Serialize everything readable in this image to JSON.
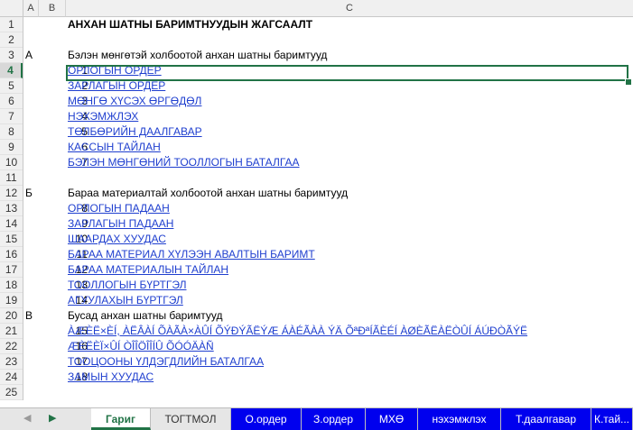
{
  "columns": {
    "a": "A",
    "b": "B",
    "c": "C"
  },
  "rows": [
    {
      "n": "1",
      "a": "",
      "num": "",
      "text": "АНХАН ШАТНЫ БАРИМТНУУДЫН ЖАГСААЛТ",
      "kind": "title"
    },
    {
      "n": "2",
      "a": "",
      "num": "",
      "text": "",
      "kind": "plain"
    },
    {
      "n": "3",
      "a": "А",
      "num": "",
      "text": "Бэлэн мөнгөтэй холбоотой анхан шатны баримтууд",
      "kind": "plain"
    },
    {
      "n": "4",
      "a": "",
      "num": "1",
      "text": "ОРЛОГЫН ОРДЕР",
      "kind": "link"
    },
    {
      "n": "5",
      "a": "",
      "num": "2",
      "text": "ЗАРЛАГЫН ОРДЕР",
      "kind": "link"
    },
    {
      "n": "6",
      "a": "",
      "num": "3",
      "text": "МӨНГӨ ХҮСЭХ ӨРГӨДӨЛ",
      "kind": "link"
    },
    {
      "n": "7",
      "a": "",
      "num": "4",
      "text": "НЭХЭМЖЛЭХ",
      "kind": "link"
    },
    {
      "n": "8",
      "a": "",
      "num": "5",
      "text": "ТӨЛБӨРИЙН ДААЛГАВАР",
      "kind": "link"
    },
    {
      "n": "9",
      "a": "",
      "num": "6",
      "text": "КАССЫН ТАЙЛАН",
      "kind": "link"
    },
    {
      "n": "10",
      "a": "",
      "num": "7",
      "text": "БЭЛЭН МӨНГӨНИЙ ТООЛЛОГЫН БАТАЛГАА",
      "kind": "link"
    },
    {
      "n": "11",
      "a": "",
      "num": "",
      "text": "",
      "kind": "plain"
    },
    {
      "n": "12",
      "a": "Б",
      "num": "",
      "text": "Бараа материалтай холбоотой анхан шатны баримтууд",
      "kind": "plain"
    },
    {
      "n": "13",
      "a": "",
      "num": "8",
      "text": "ОРЛОГЫН ПАДААН",
      "kind": "link"
    },
    {
      "n": "14",
      "a": "",
      "num": "9",
      "text": "ЗАРЛАГЫН ПАДААН",
      "kind": "link"
    },
    {
      "n": "15",
      "a": "",
      "num": "10",
      "text": "ШААРДАХ ХУУДАС",
      "kind": "link"
    },
    {
      "n": "16",
      "a": "",
      "num": "11",
      "text": "БАРАА МАТЕРИАЛ ХҮЛЭЭН АВАЛТЫН БАРИМТ",
      "kind": "link"
    },
    {
      "n": "17",
      "a": "",
      "num": "12",
      "text": "БАРАА МАТЕРИАЛЫН ТАЙЛАН",
      "kind": "link"
    },
    {
      "n": "18",
      "a": "",
      "num": "13",
      "text": "ТООЛЛОГЫН БҮРТГЭЛ",
      "kind": "link"
    },
    {
      "n": "19",
      "a": "",
      "num": "14",
      "text": "АГУУЛАХЫН БҮРТГЭЛ",
      "kind": "link"
    },
    {
      "n": "20",
      "a": "В",
      "num": "",
      "text": "Бусад анхан шатны баримтууд",
      "kind": "plain"
    },
    {
      "n": "21",
      "a": "",
      "num": "15",
      "text": "ÀÆÈË×ÈÍ, ÀËÂÀÍ ÕÀÃÀ×ÀÛÍ ÕÝÐÝÃËÝÆ ÁÀÉÃÀÀ ÝÄ ÕªÐªÍÃÈÉÍ ÀØÈÃËÀËÒÛÍ ÁÚÐÒÃÝË",
      "kind": "link"
    },
    {
      "n": "22",
      "a": "",
      "num": "16",
      "text": "ÆÈËÈÏ×ÛÍ ÒÎÎÖÎÎÍÛ ÕÓÓÄÀÑ",
      "kind": "link"
    },
    {
      "n": "23",
      "a": "",
      "num": "17",
      "text": "ТООЦООНЫ ҮЛДЭГДЛИЙН БАТАЛГАА",
      "kind": "link"
    },
    {
      "n": "24",
      "a": "",
      "num": "18",
      "text": "ЗАМЫН ХУУДАС",
      "kind": "link"
    },
    {
      "n": "25",
      "a": "",
      "num": "",
      "text": "",
      "kind": "plain"
    }
  ],
  "selected_row": "4",
  "tabs": [
    {
      "label": "Гариг",
      "style": "active"
    },
    {
      "label": "ТОГТМОЛ",
      "style": "plain"
    },
    {
      "label": "О.ордер",
      "style": "blue"
    },
    {
      "label": "З.ордер",
      "style": "blue"
    },
    {
      "label": "МХӨ",
      "style": "blue"
    },
    {
      "label": "нэхэмжлэх",
      "style": "blue"
    },
    {
      "label": "Т.даалгавар",
      "style": "blue"
    },
    {
      "label": "К.тай...",
      "style": "blue"
    }
  ],
  "colors": {
    "accent": "#217346",
    "link": "#1f3fcf",
    "tab_blue": "#0000ee"
  }
}
